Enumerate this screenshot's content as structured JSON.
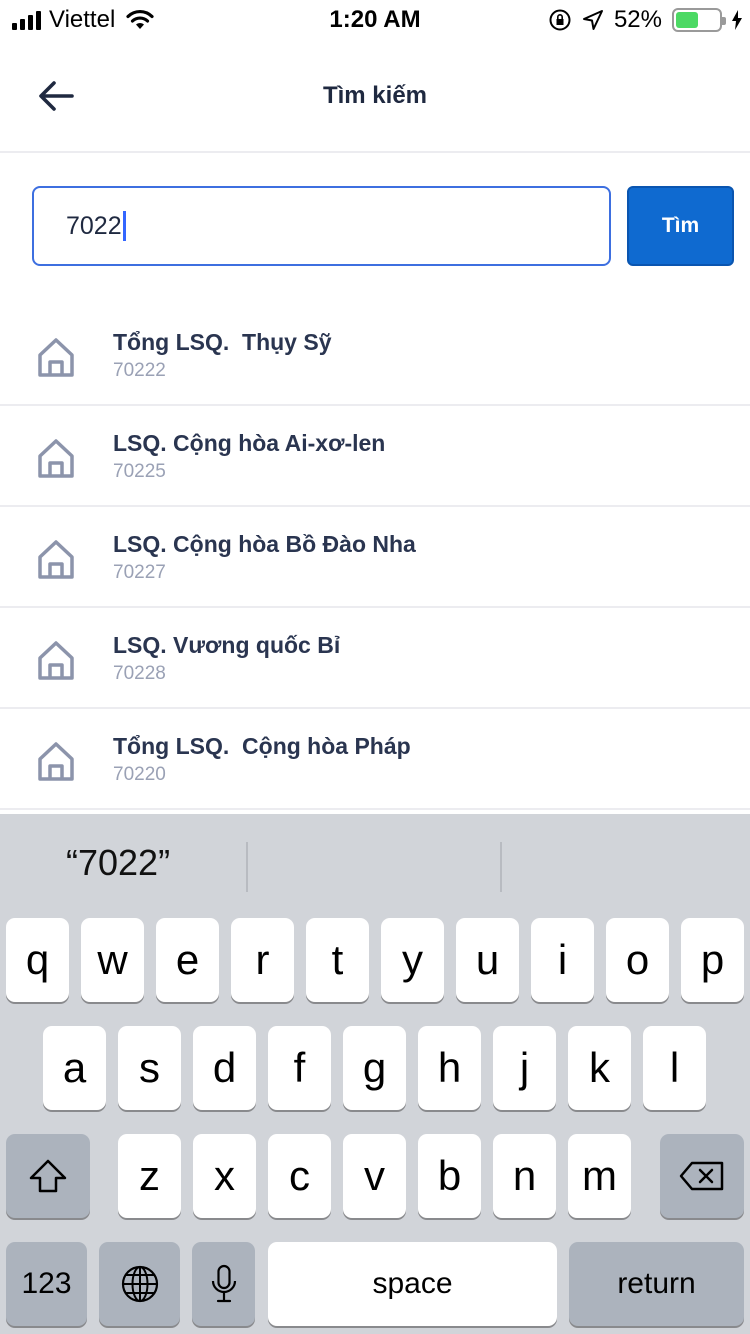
{
  "status_bar": {
    "carrier": "Viettel",
    "time": "1:20 AM",
    "battery_percent": "52%",
    "battery_level": 0.52
  },
  "nav": {
    "title": "Tìm kiếm"
  },
  "search": {
    "value": "7022",
    "button_label": "Tìm"
  },
  "results": [
    {
      "name": "Tổng LSQ.  Thụy Sỹ",
      "code": "70222"
    },
    {
      "name": "LSQ. Cộng hòa Ai-xơ-len",
      "code": "70225"
    },
    {
      "name": "LSQ. Cộng hòa Bồ Đào Nha",
      "code": "70227"
    },
    {
      "name": "LSQ. Vương quốc Bỉ",
      "code": "70228"
    },
    {
      "name": "Tổng LSQ.  Cộng hòa Pháp",
      "code": "70220"
    }
  ],
  "keyboard": {
    "prediction": "“7022”",
    "row1": [
      "q",
      "w",
      "e",
      "r",
      "t",
      "y",
      "u",
      "i",
      "o",
      "p"
    ],
    "row2": [
      "a",
      "s",
      "d",
      "f",
      "g",
      "h",
      "j",
      "k",
      "l"
    ],
    "row3": [
      "z",
      "x",
      "c",
      "v",
      "b",
      "n",
      "m"
    ],
    "numbers_label": "123",
    "space_label": "space",
    "return_label": "return"
  },
  "colors": {
    "accent": "#0f6ad0",
    "input_border": "#3d6fe0",
    "battery": "#4cd964"
  }
}
